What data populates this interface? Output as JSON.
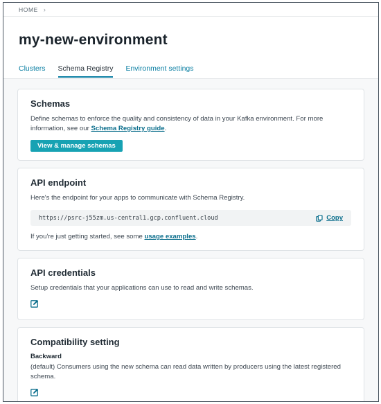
{
  "breadcrumb": {
    "home": "HOME",
    "separator": "›"
  },
  "page": {
    "title": "my-new-environment"
  },
  "tabs": [
    {
      "label": "Clusters",
      "active": false
    },
    {
      "label": "Schema Registry",
      "active": true
    },
    {
      "label": "Environment settings",
      "active": false
    }
  ],
  "schemas": {
    "title": "Schemas",
    "description": "Define schemas to enforce the quality and consistency of data in your Kafka environment. For more information, see our",
    "link": "Schema Registry guide",
    "after": ".",
    "button": "View & manage schemas"
  },
  "api_endpoint": {
    "title": "API endpoint",
    "description": "Here's the endpoint for your apps to communicate with Schema Registry.",
    "url": "https://psrc-j55zm.us-central1.gcp.confluent.cloud",
    "copy": "Copy",
    "hint": "If you're just getting started, see some",
    "hint_link": "usage examples",
    "hint_after": "."
  },
  "api_credentials": {
    "title": "API credentials",
    "description": "Setup credentials that your applications can use to read and write schemas."
  },
  "compatibility": {
    "title": "Compatibility setting",
    "mode": "Backward",
    "description": "(default) Consumers using the new schema can read data written by producers using the latest registered schema."
  },
  "colors": {
    "accent": "#17a2b3",
    "link": "#0b6e8c"
  },
  "icons": {
    "edit": "edit-icon",
    "copy": "copy-icon"
  }
}
